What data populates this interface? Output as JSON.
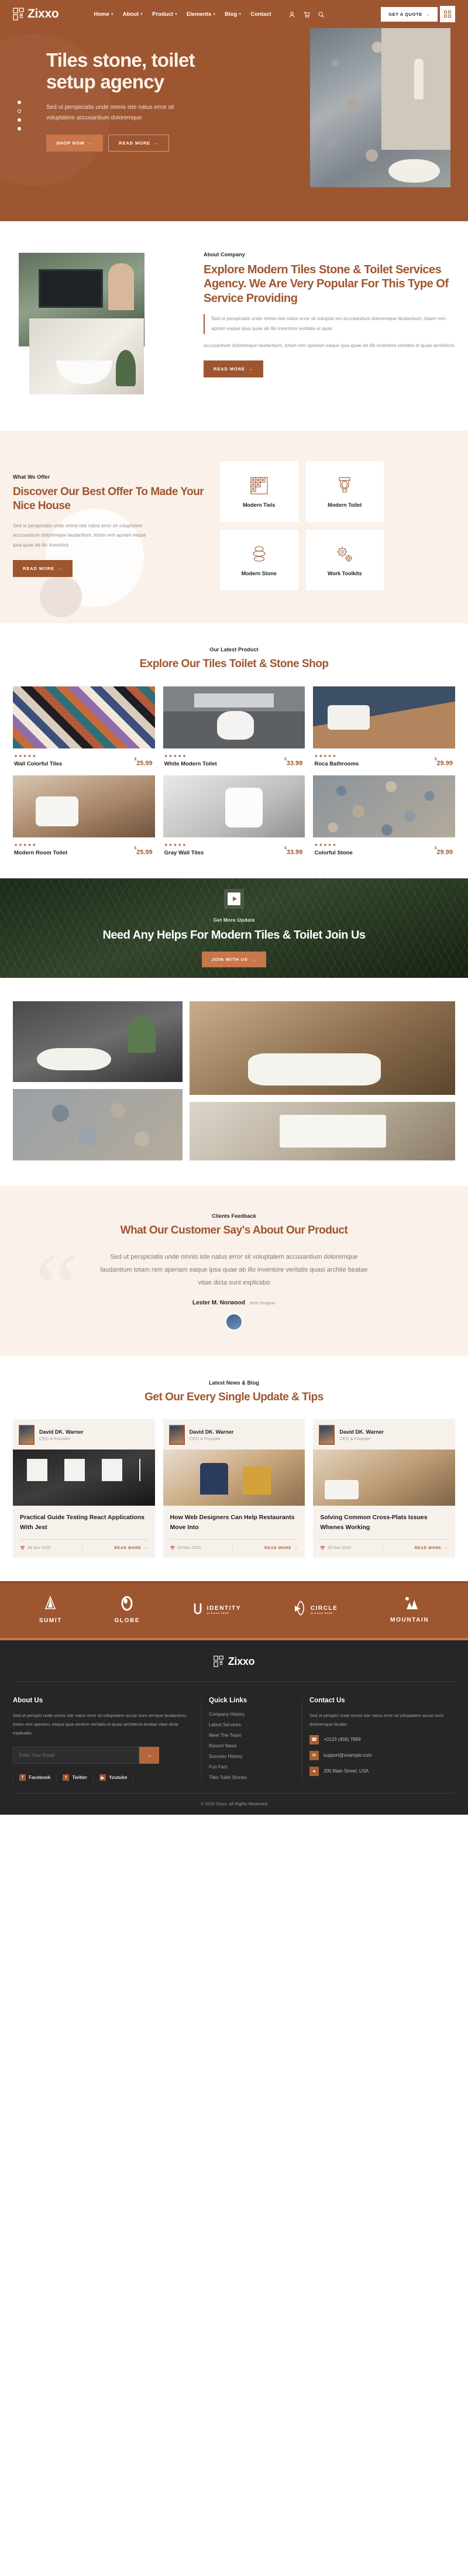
{
  "header": {
    "brand": "Zixxo",
    "nav": [
      {
        "label": "Home",
        "caret": true
      },
      {
        "label": "About",
        "caret": true
      },
      {
        "label": "Product",
        "caret": true
      },
      {
        "label": "Elements",
        "caret": true
      },
      {
        "label": "Blog",
        "caret": true
      },
      {
        "label": "Contact",
        "caret": false
      }
    ],
    "icons": [
      "user-icon",
      "cart-icon",
      "search-icon"
    ],
    "quote_button": "GET A QUOTE",
    "quote_arrow": "→",
    "grid_button": "grid-menu-icon"
  },
  "hero": {
    "title": "Tiles stone, toilet setup agency",
    "paragraph": "Sed ut perspiciatis unde omnis iste natus error sit voluptatem accusantium doloremque",
    "primary_button": "SHOP NOW",
    "secondary_button": "READ MORE",
    "arrow": "→",
    "dots": 4
  },
  "about": {
    "label": "About Company",
    "title": "Explore Modern Tiles Stone & Toilet Services Agency. We Are Very Popular For This Type Of Service Providing",
    "quote": "Sed ut perspiciatis unde omnis iste natus error sit voluptat em accusantium doloremque laudantium, totam rem apriam eaque ipsa quae ab illo inventore veritatis et quas",
    "paragraph": "accusantium doloremque laudantium, totam rem aperiam eaque ipsa quae ab illo inventore veritatis et quasi architecto",
    "button": "READ MORE",
    "arrow": "→"
  },
  "offer": {
    "label": "What We Offer",
    "title": "Discover Our Best Offer To Made Your Nice House",
    "paragraph": "Sed ut perspiciatis unde omnis iste natus error sit voluptatem accusantium doloremque laudantium, totam rem apriam eaque ipsa quae ab illo inventore",
    "button": "READ MORE",
    "arrow": "→",
    "cards": [
      {
        "label": "Modern Tiels",
        "icon": "tiles-icon"
      },
      {
        "label": "Modern Toilet",
        "icon": "toilet-icon"
      },
      {
        "label": "Modern Stone",
        "icon": "stone-stack-icon"
      },
      {
        "label": "Work Toolkits",
        "icon": "gears-icon"
      }
    ]
  },
  "products": {
    "label": "Our Latest Product",
    "title": "Explore Our Tiles Toilet & Stone Shop",
    "items": [
      {
        "name": "Wall Colorful Tiles",
        "price": "25.99",
        "currency": "$",
        "stars": "★★★★★",
        "thumb": "t-tiles"
      },
      {
        "name": "White Modern Toilet",
        "price": "33.99",
        "currency": "$",
        "stars": "★★★★★",
        "thumb": "t-toilet"
      },
      {
        "name": "Roca Bathrooms",
        "price": "29.99",
        "currency": "$",
        "stars": "★★★★★",
        "thumb": "t-roca"
      },
      {
        "name": "Modern Room Toilet",
        "price": "25.99",
        "currency": "$",
        "stars": "★★★★★",
        "thumb": "t-room"
      },
      {
        "name": "Gray Wall Tiles",
        "price": "33.99",
        "currency": "$",
        "stars": "★★★★★",
        "thumb": "t-gray"
      },
      {
        "name": "Colorful Stone",
        "price": "29.99",
        "currency": "$",
        "stars": "★★★★★",
        "thumb": "t-stone"
      }
    ]
  },
  "cta": {
    "label": "Get More Update",
    "title": "Need Any Helps For Modern Tiles & Toilet Join Us",
    "button": "JOIN WITH US",
    "arrow": "→",
    "play_icon": "play-icon"
  },
  "testimonial": {
    "label": "Clients Feedback",
    "title": "What Our Customer Say's About Our Product",
    "quote": "Sed ut perspiciatis unde omnis iste natus error sit voluptatem accusantium doloremque laudantium totam rem aperiam eaque ipsa quae ab illo inventore veritatis quasi archite beatae vitae dicta sunt explicabo",
    "author": "Lester M. Norwood",
    "role": "Web Designer"
  },
  "blog": {
    "label": "Latest News & Blog",
    "title": "Get Our Every Single Update & Tips",
    "read_more": "READ MORE",
    "arrow": "→",
    "posts": [
      {
        "author": "David DK. Warner",
        "role": "CEO & Founder",
        "title": "Practical Guide Testing React Applications With Jest",
        "date": "28 Nov 2020",
        "thumb": "bt1"
      },
      {
        "author": "David DK. Warner",
        "role": "CEO & Founder",
        "title": "How Web Designers Can Help Restaurants Move Into",
        "date": "29 Nov 2020",
        "thumb": "bt2"
      },
      {
        "author": "David DK. Warner",
        "role": "CEO & Founder",
        "title": "Solving Common Cross-Plats Issues Whenes Working",
        "date": "30 Nov 2020",
        "thumb": "bt3"
      }
    ]
  },
  "brands": [
    {
      "name": "SUMIT",
      "slogan": "",
      "icon": "sumit-triangle-icon"
    },
    {
      "name": "GLOBE",
      "slogan": "",
      "icon": "globe-ring-icon"
    },
    {
      "name": "IDENTITY",
      "slogan": "SLOGAN HERE",
      "icon": "identity-clip-icon"
    },
    {
      "name": "CIRCLE",
      "slogan": "SLOGAN HERE",
      "icon": "circle-star-icon"
    },
    {
      "name": "MOUNTAIN",
      "slogan": "",
      "icon": "mountain-icon"
    }
  ],
  "footer": {
    "brand": "Zixxo",
    "about": {
      "heading": "About Us",
      "text": "Sed ut perspici unde omnis iste natus error sit voluptatem accan tium remque laudantium, totam rem aperiam, eaque ipsa ventore veritatis et quasi architecto beatae vitae dicta explicabo.",
      "email_placeholder": "Enter Your Email",
      "submit_arrow": "→",
      "socials": [
        {
          "label": "Facebook",
          "glyph": "f"
        },
        {
          "label": "Twitter",
          "glyph": "t"
        },
        {
          "label": "Youtube",
          "glyph": "▶"
        }
      ]
    },
    "quick_links": {
      "heading": "Quick Links",
      "links": [
        "Company History",
        "Latest Services",
        "Meet The Team",
        "Recent News",
        "Success History",
        "Fun Fact",
        "Tiles Toilet Stones"
      ]
    },
    "contact": {
      "heading": "Contact Us",
      "text": "Sed ut perspici unde omnis iste natus error sit voluptatem accan tium doloremque laudan",
      "phone": "+0123 (456) 7899",
      "email": "support@example.com",
      "address": "205 Main Street, USA",
      "phone_icon": "phone-icon",
      "email_icon": "mail-icon",
      "address_icon": "location-icon"
    },
    "copyright": "© 2020 Zixxo. All Rights Reserved"
  }
}
